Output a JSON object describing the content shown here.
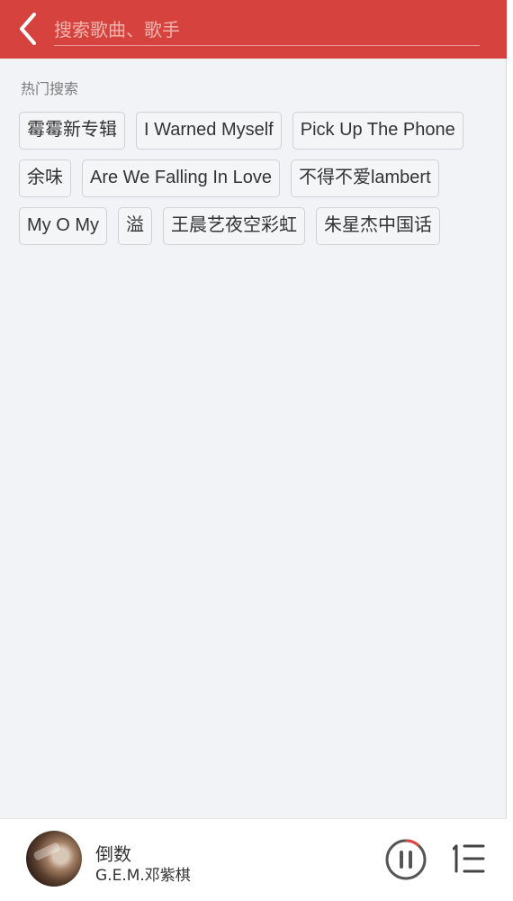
{
  "header": {
    "back_icon": "chevron-left-icon",
    "search_placeholder": "搜索歌曲、歌手",
    "accent_color": "#d6423d"
  },
  "hot_search": {
    "title": "热门搜索",
    "tags": [
      "霉霉新专辑",
      "I Warned Myself",
      "Pick Up The Phone",
      "余味",
      "Are We Falling In Love",
      "不得不爱lambert",
      "My O My",
      "溢",
      "王晨艺夜空彩虹",
      "朱星杰中国话"
    ]
  },
  "player": {
    "song_title": "倒数",
    "artist": "G.E.M.邓紫棋",
    "progress": 0.12,
    "play_icon": "pause-icon",
    "playlist_icon": "playlist-icon"
  }
}
